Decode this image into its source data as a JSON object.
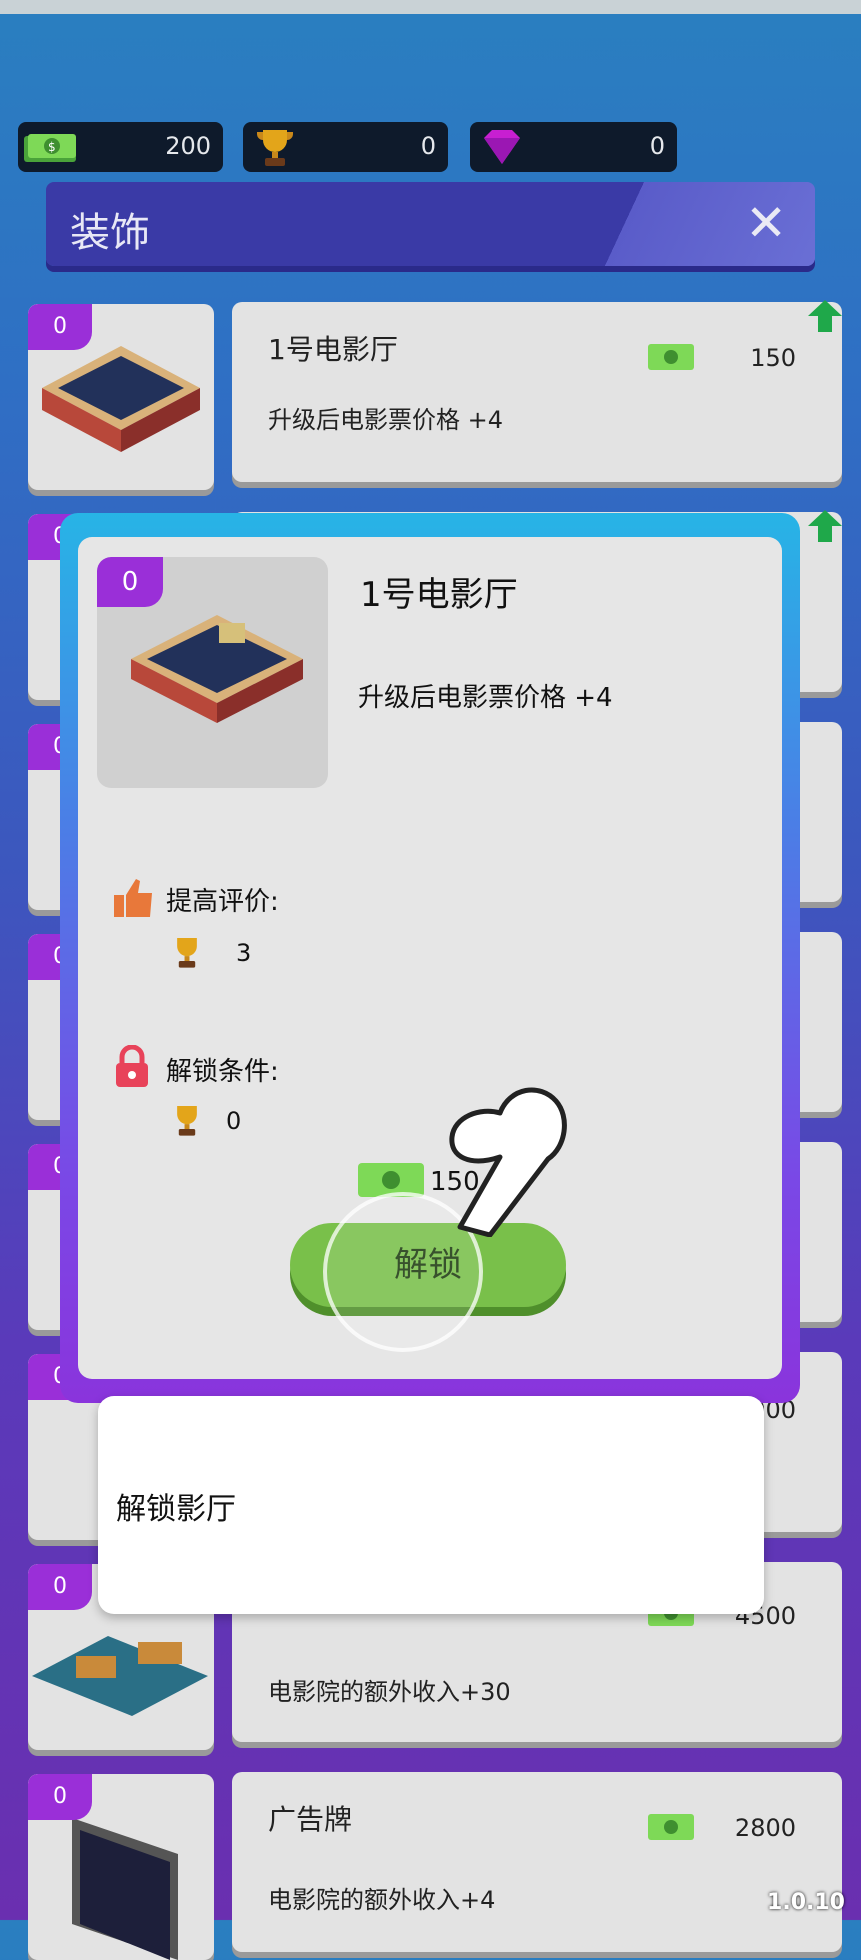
{
  "resources": [
    {
      "icon": "cash-icon",
      "value": "200"
    },
    {
      "icon": "trophy-icon",
      "value": "0"
    },
    {
      "icon": "gem-icon",
      "value": "0"
    }
  ],
  "panel": {
    "title": "装饰",
    "close": "✕"
  },
  "list": [
    {
      "badge": "0",
      "name": "1号电影厅",
      "desc": "升级后电影票价格 +4",
      "price": "150"
    },
    {
      "badge": "0"
    },
    {
      "badge": "0"
    },
    {
      "badge": "0"
    },
    {
      "badge": "0"
    },
    {
      "badge": "0",
      "price": "5000"
    },
    {
      "badge": "0",
      "desc": "电影院的额外收入+30",
      "price": "4500"
    },
    {
      "badge": "0",
      "name": "广告牌",
      "desc": "电影院的额外收入+4",
      "price": "2800"
    }
  ],
  "popup": {
    "badge": "0",
    "title": "1号电影厅",
    "desc": "升级后电影票价格 +4",
    "rating_label": "提高评价:",
    "rating_value": "3",
    "unlock_label": "解锁条件:",
    "unlock_value": "0",
    "cost": "150",
    "button": "解锁"
  },
  "tooltip": {
    "text": "解锁影厅"
  },
  "version": "1.0.10",
  "colors": {
    "badge": "#9a2fd8",
    "button": "#79c04a",
    "cash": "#7ed957"
  }
}
